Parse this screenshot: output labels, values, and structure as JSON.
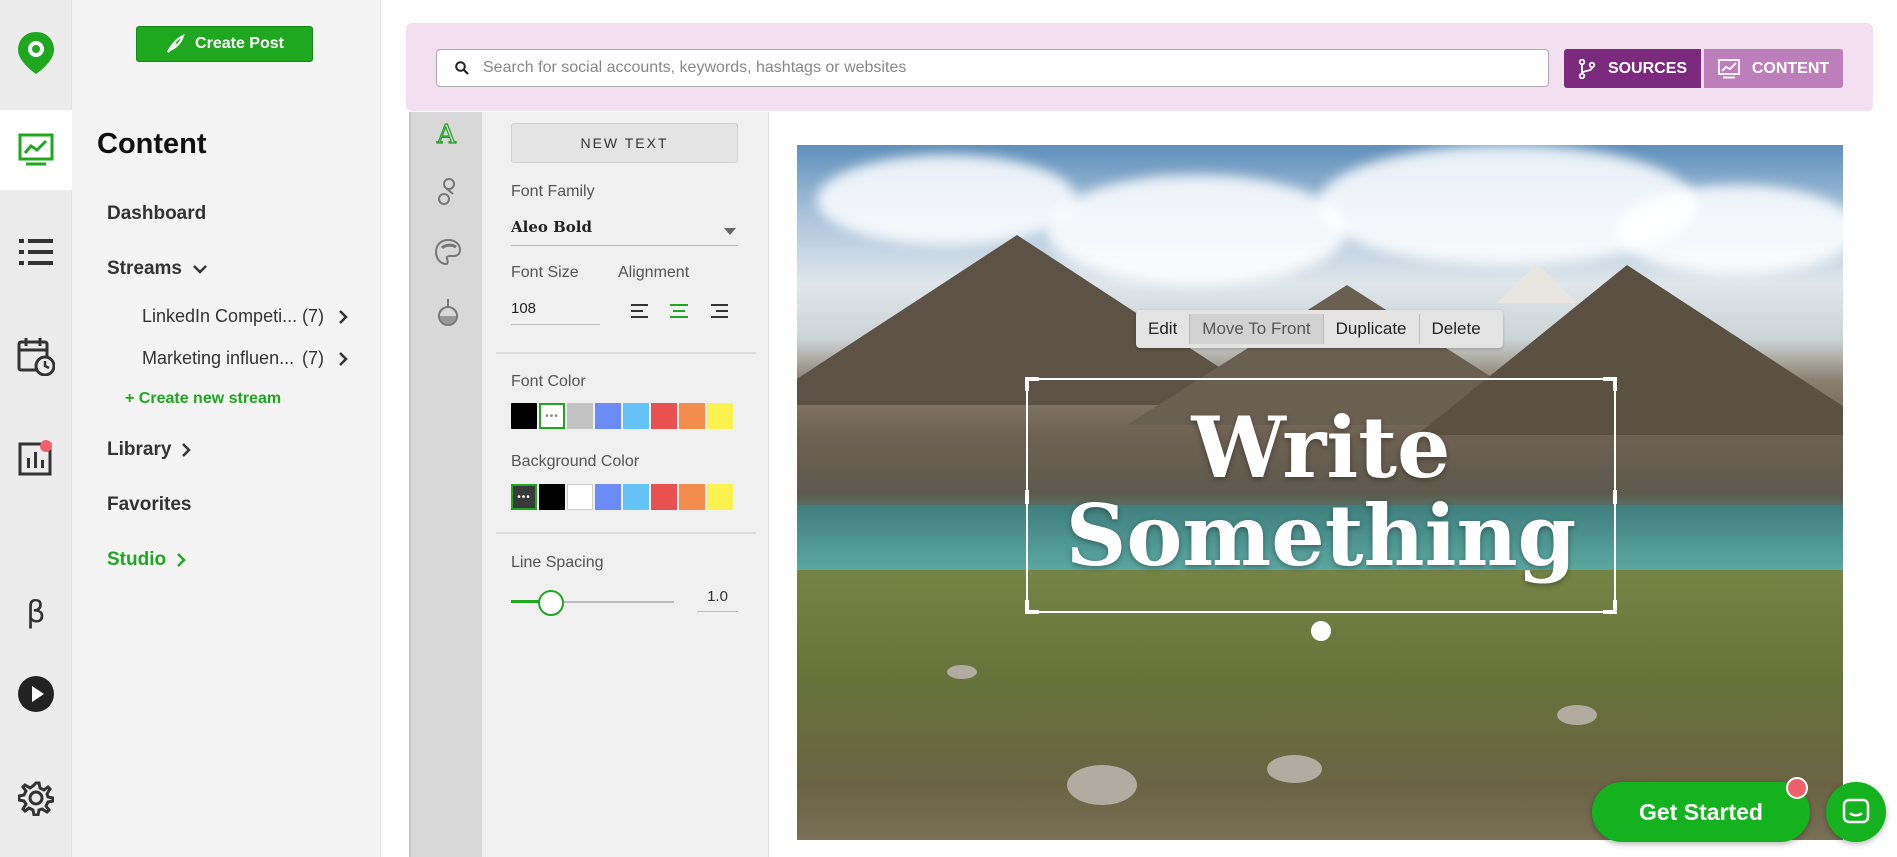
{
  "rail": {
    "icons": [
      "logo-pin-icon",
      "content-chart-icon",
      "list-icon",
      "calendar-clock-icon",
      "analytics-icon",
      "beta-icon",
      "play-icon",
      "gear-icon"
    ],
    "beta_label": "β",
    "accent": "#1fa81f",
    "notification_color": "#f0606a"
  },
  "nav": {
    "create_post": "Create Post",
    "title": "Content",
    "dashboard": "Dashboard",
    "streams": "Streams",
    "stream_items": [
      {
        "name": "LinkedIn Competi...",
        "count": "(7)"
      },
      {
        "name": "Marketing influen...",
        "count": "(7)"
      }
    ],
    "create_stream": "+ Create new stream",
    "library": "Library",
    "favorites": "Favorites",
    "studio": "Studio"
  },
  "header": {
    "search_placeholder": "Search for social accounts, keywords, hashtags or websites",
    "sources": "SOURCES",
    "content": "CONTENT",
    "sources_color": "#7b2a7e",
    "content_color": "#bd7fbc"
  },
  "tools": [
    "text-tool-icon",
    "shapes-tool-icon",
    "color-tool-icon",
    "filter-tool-icon"
  ],
  "text_panel": {
    "new_text": "NEW TEXT",
    "font_family_label": "Font Family",
    "font_family_value": "Aleo Bold",
    "font_size_label": "Font Size",
    "font_size_value": "108",
    "alignment_label": "Alignment",
    "alignment_selected": "center",
    "font_color_label": "Font Color",
    "font_colors": [
      "#000000",
      "#ffffff",
      "#c2c2c2",
      "#6b8cf7",
      "#63c3f7",
      "#e8514f",
      "#f38c4d",
      "#fbf14f"
    ],
    "font_color_selected": 1,
    "background_color_label": "Background Color",
    "background_colors": [
      "#3a3a3a",
      "#000000",
      "#ffffff",
      "#6b8cf7",
      "#63c3f7",
      "#e8514f",
      "#f38c4d",
      "#fbf14f"
    ],
    "background_color_selected": 0,
    "line_spacing_label": "Line Spacing",
    "line_spacing_value": "1.0",
    "line_spacing_fraction": 0.2
  },
  "canvas": {
    "context_menu": [
      "Edit",
      "Move To Front",
      "Duplicate",
      "Delete"
    ],
    "context_active": 1,
    "text_line1": "Write",
    "text_line2": "Something"
  },
  "cta": {
    "get_started": "Get Started"
  }
}
